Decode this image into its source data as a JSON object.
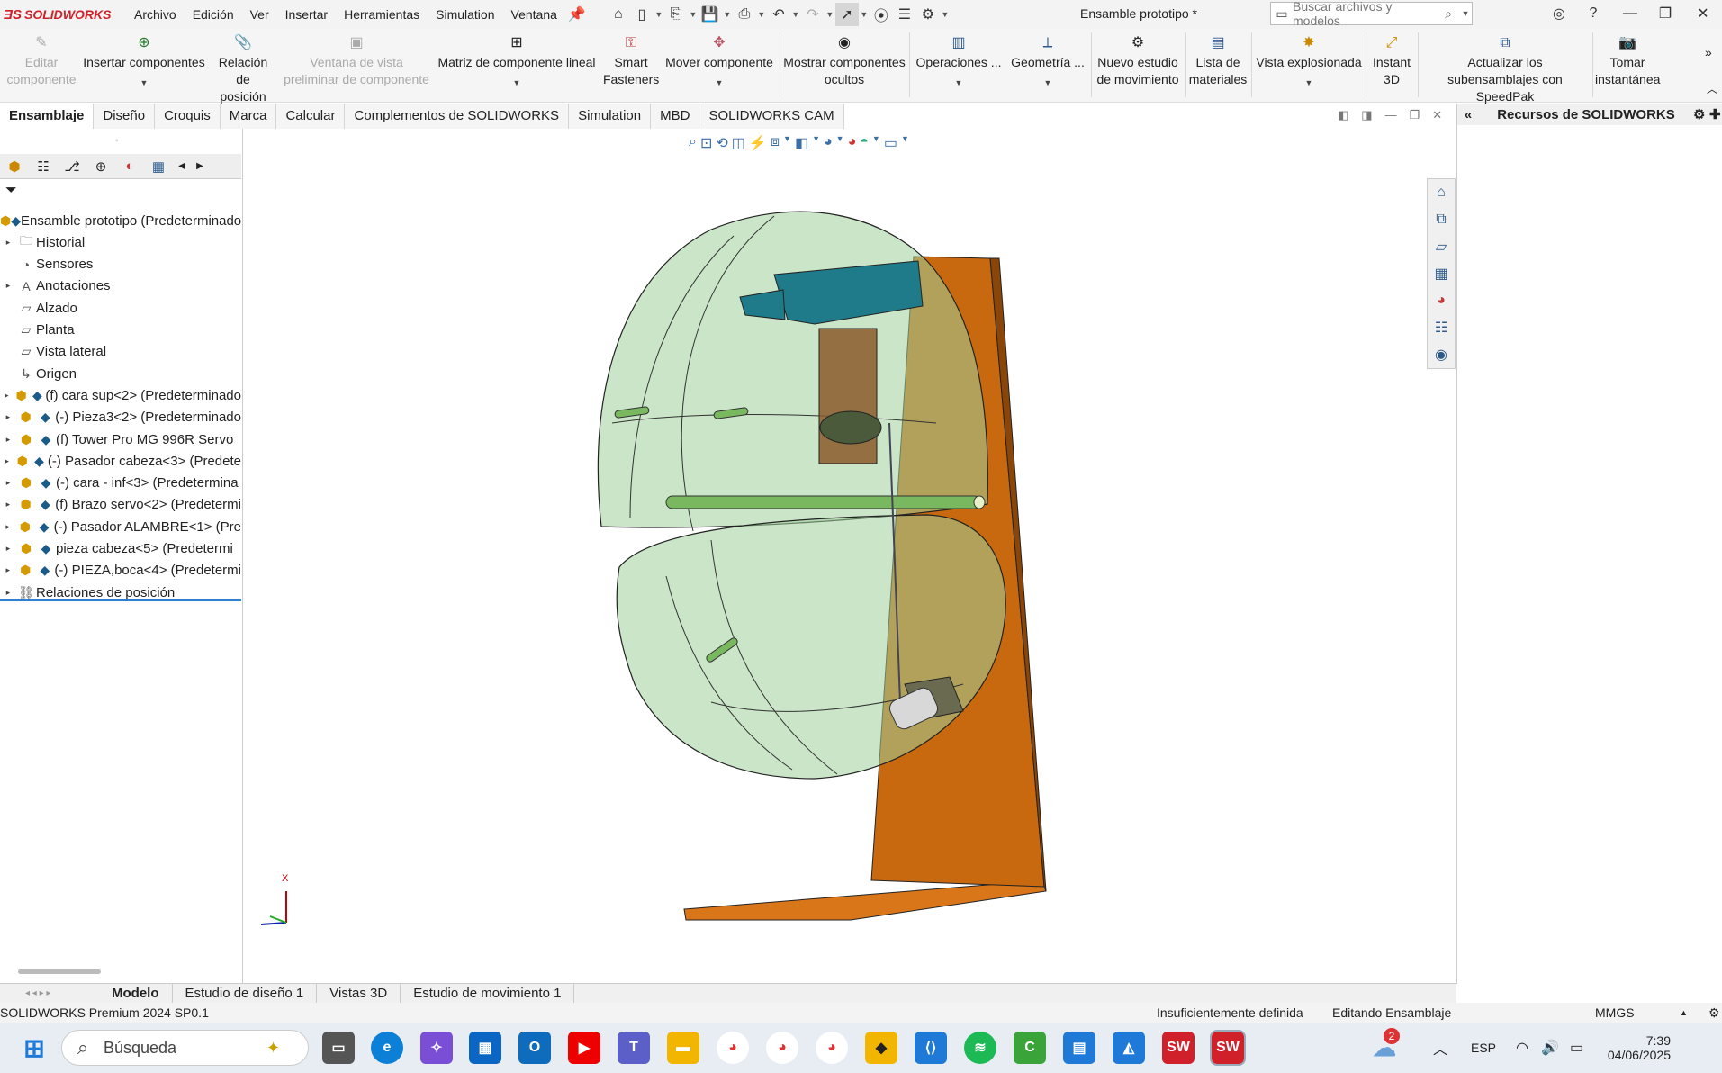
{
  "app": {
    "logo": "SOLIDWORKS",
    "title": "Ensamble prototipo *"
  },
  "menu": [
    "Archivo",
    "Edición",
    "Ver",
    "Insertar",
    "Herramientas",
    "Simulation",
    "Ventana"
  ],
  "search": {
    "placeholder": "Buscar archivos y modelos"
  },
  "commands": [
    {
      "label": "Editar componente",
      "disabled": true
    },
    {
      "label": "Insertar componentes"
    },
    {
      "label": "Relación de posición"
    },
    {
      "label": "Ventana de vista preliminar de componente",
      "disabled": true
    },
    {
      "label": "Matriz de componente lineal"
    },
    {
      "label": "Smart Fasteners"
    },
    {
      "label": "Mover componente"
    },
    {
      "label": "Mostrar componentes ocultos"
    },
    {
      "label": "Operaciones ..."
    },
    {
      "label": "Geometría ..."
    },
    {
      "label": "Nuevo estudio de movimiento"
    },
    {
      "label": "Lista de materiales"
    },
    {
      "label": "Vista explosionada"
    },
    {
      "label": "Instant 3D"
    },
    {
      "label": "Actualizar los subensamblajes con SpeedPak"
    },
    {
      "label": "Tomar instantánea"
    }
  ],
  "tabs": [
    "Ensamblaje",
    "Diseño",
    "Croquis",
    "Marca",
    "Calcular",
    "Complementos de SOLIDWORKS",
    "Simulation",
    "MBD",
    "SOLIDWORKS CAM"
  ],
  "tree": [
    {
      "label": "Ensamble prototipo  (Predeterminado",
      "kind": "root"
    },
    {
      "label": "Historial",
      "kind": "folder",
      "exp": true
    },
    {
      "label": "Sensores",
      "kind": "sensor"
    },
    {
      "label": "Anotaciones",
      "kind": "annot",
      "exp": true
    },
    {
      "label": "Alzado",
      "kind": "plane"
    },
    {
      "label": "Planta",
      "kind": "plane"
    },
    {
      "label": "Vista lateral",
      "kind": "plane"
    },
    {
      "label": "Origen",
      "kind": "origin"
    },
    {
      "label": "(f) cara sup<2> (Predeterminado",
      "kind": "part",
      "exp": true
    },
    {
      "label": "(-) Pieza3<2> (Predeterminado",
      "kind": "part",
      "exp": true
    },
    {
      "label": "(f) Tower Pro MG 996R Servo",
      "kind": "part",
      "exp": true
    },
    {
      "label": "(-) Pasador cabeza<3> (Predete",
      "kind": "part",
      "exp": true
    },
    {
      "label": "(-) cara - inf<3> (Predetermina",
      "kind": "part",
      "exp": true
    },
    {
      "label": "(f) Brazo servo<2> (Predetermi",
      "kind": "part",
      "exp": true
    },
    {
      "label": "(-) Pasador ALAMBRE<1> (Pre",
      "kind": "part",
      "exp": true
    },
    {
      "label": "pieza cabeza<5> (Predetermi",
      "kind": "part",
      "exp": true
    },
    {
      "label": "(-) PIEZA,boca<4> (Predetermi",
      "kind": "part",
      "exp": true
    },
    {
      "label": "Relaciones de posición",
      "kind": "mates",
      "exp": true
    }
  ],
  "taskpane": {
    "title": "Recursos de SOLIDWORKS"
  },
  "bottom_tabs": [
    "Modelo",
    "Estudio de diseño 1",
    "Vistas 3D",
    "Estudio de movimiento 1"
  ],
  "status": {
    "product": "SOLIDWORKS Premium 2024 SP0.1",
    "definition": "Insuficientemente definida",
    "mode": "Editando Ensamblaje",
    "units": "MMGS"
  },
  "taskbar": {
    "search": "Búsqueda",
    "lang": "ESP",
    "time": "7:39",
    "date": "04/06/2025",
    "badge": "2"
  },
  "triad": {
    "axis_label": "X"
  }
}
